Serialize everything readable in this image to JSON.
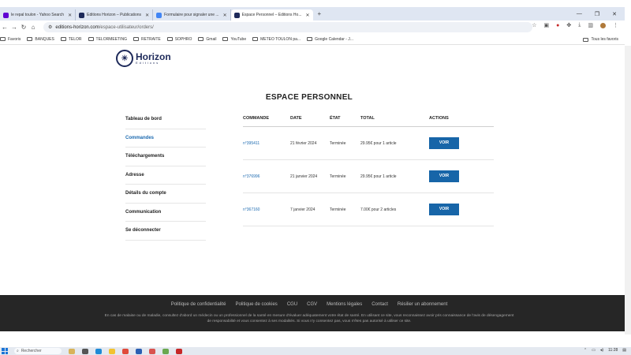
{
  "browser": {
    "tabs": [
      {
        "title": "le repal toulon - Yahoo Search",
        "color": "#6001d2"
      },
      {
        "title": "Editions Horizon – Publications",
        "color": "#1e2a5a"
      },
      {
        "title": "Formulaire pour signaler une ...",
        "color": "#4285f4"
      },
      {
        "title": "Espace Personnel – Editions Ho...",
        "color": "#1e2a5a",
        "active": true
      }
    ],
    "new_tab": "+",
    "url_domain": "editions-horizon.com",
    "url_path": "/espace-utilisateur/orders/",
    "bookmarks": [
      "Favoris",
      "BANQUES",
      "TELOR",
      "TELORMEETING",
      "RETRAITE",
      "SOPHRO",
      "Gmail",
      "YouTube",
      "METEO TOULON pa...",
      "Google Calendar - J..."
    ],
    "bookmarks_right": "Tous les favoris"
  },
  "logo": {
    "name": "Horizon",
    "sub": "Editions"
  },
  "page_title": "ESPACE PERSONNEL",
  "sidebar": [
    {
      "label": "Tableau de bord"
    },
    {
      "label": "Commandes",
      "active": true
    },
    {
      "label": "Téléchargements"
    },
    {
      "label": "Adresse"
    },
    {
      "label": "Détails du compte"
    },
    {
      "label": "Communication"
    },
    {
      "label": "Se déconnecter"
    }
  ],
  "orders": {
    "headers": [
      "COMMANDE",
      "DATE",
      "ÉTAT",
      "TOTAL",
      "ACTIONS"
    ],
    "rows": [
      {
        "id": "n°395411",
        "date": "21 février 2024",
        "status": "Terminée",
        "total": "29.95€ pour 1 article",
        "action": "VOIR"
      },
      {
        "id": "n°376996",
        "date": "21 janvier 2024",
        "status": "Terminée",
        "total": "29.95€ pour 1 article",
        "action": "VOIR"
      },
      {
        "id": "n°367160",
        "date": "7 janvier 2024",
        "status": "Terminée",
        "total": "7.00€ pour 2 articles",
        "action": "VOIR"
      }
    ]
  },
  "footer": {
    "links": [
      "Politique de confidentialité",
      "Politique de cookies",
      "CGU",
      "CGV",
      "Mentions légales",
      "Contact",
      "Résilier un abonnement"
    ],
    "disclaimer": "En cas de malaise ou de maladie, consultez d'abord un médecin ou un professionnel de la santé en mesure d'évaluer adéquatement votre état de santé. En utilisant ce site, vous reconnaissez avoir pris connaissance de l'avis de désengagement de responsabilité et vous consentez à ses modalités. Si vous n'y consentez pas, vous n'êtes pas autorisé à utiliser ce site."
  },
  "taskbar": {
    "search_placeholder": "Rechercher",
    "clock": "11:28"
  }
}
